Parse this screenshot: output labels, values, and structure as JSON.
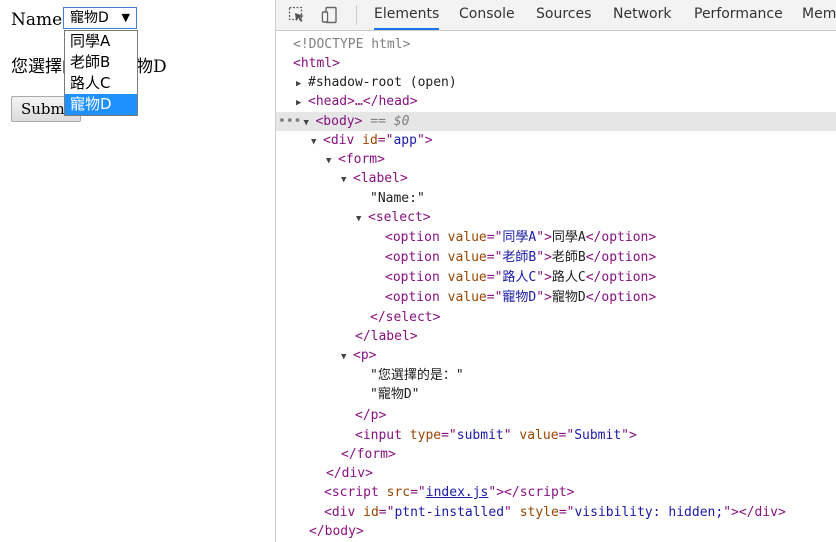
{
  "page": {
    "name_label": "Name:",
    "selected_value": "寵物D",
    "options": [
      "同學A",
      "老師B",
      "路人C",
      "寵物D"
    ],
    "result_label": "您選擇的是：",
    "result_value": "寵物D",
    "submit_label": "Submit"
  },
  "devtools": {
    "tabs": [
      "Elements",
      "Console",
      "Sources",
      "Network",
      "Performance",
      "Mem"
    ],
    "active_tab": "Elements",
    "dom": {
      "doctype": "<!DOCTYPE html>",
      "html_open": "<html>",
      "shadow_root": "#shadow-root (open)",
      "head": "<head>…</head>",
      "body_tag": "<body>",
      "body_marker": " == $0",
      "div_app": "app",
      "name_text": "\"Name:\"",
      "option_values": [
        "同學A",
        "老師B",
        "路人C",
        "寵物D"
      ],
      "p_text1": "\"您選擇的是：\"",
      "p_text2": "\"寵物D\"",
      "input_type": "submit",
      "input_value": "Submit",
      "script_src": "index.js",
      "ptnt_id": "ptnt-installed",
      "ptnt_style": "visibility: hidden;"
    }
  }
}
